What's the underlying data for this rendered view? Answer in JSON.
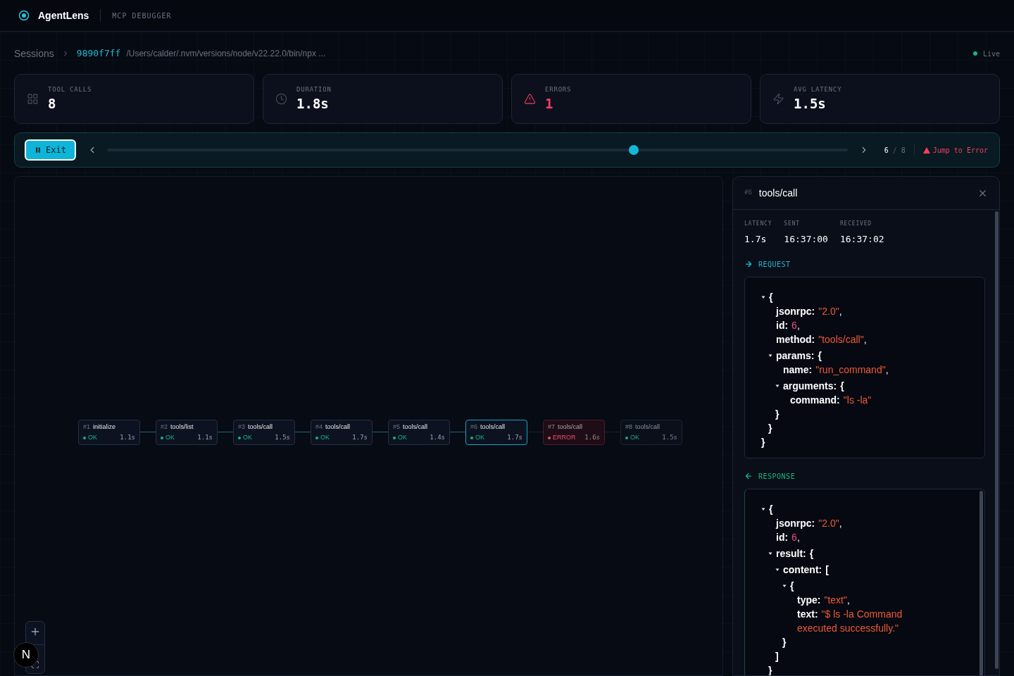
{
  "app": {
    "name": "AgentLens",
    "subtitle": "MCP DEBUGGER"
  },
  "breadcrumb": {
    "root": "Sessions",
    "session_id": "9890f7ff",
    "command": "/Users/calder/.nvm/versions/node/v22.22.0/bin/npx ...",
    "status": "Live",
    "live": true
  },
  "stats": [
    {
      "label": "TOOL CALLS",
      "value": "8",
      "kind": "calls",
      "error": false
    },
    {
      "label": "DURATION",
      "value": "1.8s",
      "kind": "duration",
      "error": false
    },
    {
      "label": "ERRORS",
      "value": "1",
      "kind": "errors",
      "error": true
    },
    {
      "label": "AVG LATENCY",
      "value": "1.5s",
      "kind": "latency",
      "error": false
    }
  ],
  "playback": {
    "exit_label": "Exit",
    "level": 0.711,
    "current": "6",
    "separator": "/",
    "total": "8",
    "jump_label": "Jump to Error"
  },
  "flow": {
    "nodes": [
      {
        "index": "#1",
        "method": "initialize",
        "status": "OK",
        "time": "1.1s",
        "kind": "done",
        "selected": false
      },
      {
        "index": "#2",
        "method": "tools/list",
        "status": "OK",
        "time": "1.1s",
        "kind": "done",
        "selected": false
      },
      {
        "index": "#3",
        "method": "tools/call",
        "status": "OK",
        "time": "1.5s",
        "kind": "done",
        "selected": false
      },
      {
        "index": "#4",
        "method": "tools/call",
        "status": "OK",
        "time": "1.7s",
        "kind": "done",
        "selected": false
      },
      {
        "index": "#5",
        "method": "tools/call",
        "status": "OK",
        "time": "1.4s",
        "kind": "done",
        "selected": false
      },
      {
        "index": "#6",
        "method": "tools/call",
        "status": "OK",
        "time": "1.7s",
        "kind": "done",
        "selected": true
      },
      {
        "index": "#7",
        "method": "tools/call",
        "status": "ERROR",
        "time": "1.6s",
        "kind": "error",
        "selected": false
      },
      {
        "index": "#8",
        "method": "tools/call",
        "status": "OK",
        "time": "1.5s",
        "kind": "pending",
        "selected": false
      }
    ],
    "dev_badge": "N"
  },
  "detail": {
    "index": "#6",
    "method": "tools/call",
    "metrics": [
      {
        "label": "LATENCY",
        "value": "1.7s"
      },
      {
        "label": "SENT",
        "value": "16:37:00"
      },
      {
        "label": "RECEIVED",
        "value": "16:37:02"
      }
    ],
    "request": {
      "title": "REQUEST",
      "tree": {
        "open": "{",
        "close": "}",
        "expanded": true,
        "children": [
          {
            "key": "jsonrpc:",
            "value": "\"2.0\"",
            "kind": "string",
            "suffix": ","
          },
          {
            "key": "id:",
            "value": "6",
            "kind": "number",
            "suffix": ","
          },
          {
            "key": "method:",
            "value": "\"tools/call\"",
            "kind": "string",
            "suffix": ","
          },
          {
            "key": "params:",
            "open": "{",
            "close": "}",
            "expanded": true,
            "children": [
              {
                "key": "name:",
                "value": "\"run_command\"",
                "kind": "string",
                "suffix": ","
              },
              {
                "key": "arguments:",
                "open": "{",
                "close": "}",
                "expanded": true,
                "children": [
                  {
                    "key": "command:",
                    "value": "\"ls -la\"",
                    "kind": "string"
                  }
                ]
              }
            ]
          }
        ]
      }
    },
    "response": {
      "title": "RESPONSE",
      "tree": {
        "open": "{",
        "expanded": true,
        "children": [
          {
            "key": "jsonrpc:",
            "value": "\"2.0\"",
            "kind": "string",
            "suffix": ","
          },
          {
            "key": "id:",
            "value": "6",
            "kind": "number",
            "suffix": ","
          },
          {
            "key": "result:",
            "open": "{",
            "close": "}",
            "expanded": true,
            "children": [
              {
                "key": "content:",
                "open": "[",
                "close": "]",
                "expanded": true,
                "children": [
                  {
                    "open": "{",
                    "close": "}",
                    "expanded": true,
                    "children": [
                      {
                        "key": "type:",
                        "value": "\"text\"",
                        "kind": "string",
                        "suffix": ","
                      },
                      {
                        "key": "text:",
                        "value": "\"$ ls -la Command executed successfully.\"",
                        "kind": "string"
                      }
                    ]
                  }
                ]
              }
            ]
          }
        ]
      }
    }
  }
}
